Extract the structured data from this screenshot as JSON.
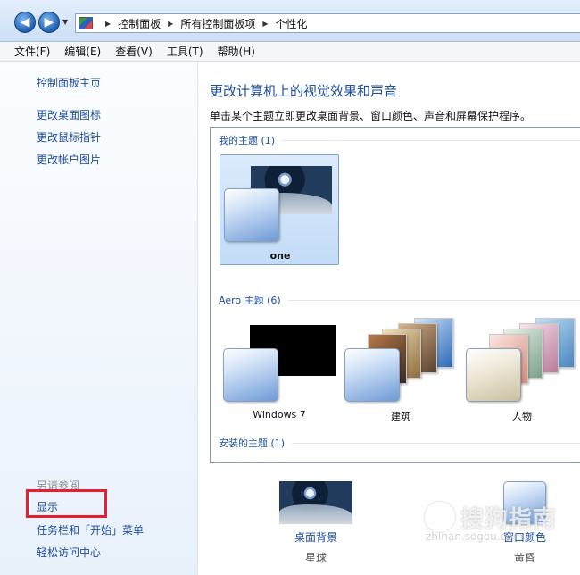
{
  "address": {
    "crumbs": [
      "控制面板",
      "所有控制面板项",
      "个性化"
    ]
  },
  "menu": [
    "文件(F)",
    "编辑(E)",
    "查看(V)",
    "工具(T)",
    "帮助(H)"
  ],
  "sidebar": {
    "home": "控制面板主页",
    "links": [
      "更改桌面图标",
      "更改鼠标指针",
      "更改帐户图片"
    ],
    "see_also": "另请参阅",
    "bottom_links": [
      "显示",
      "任务栏和「开始」菜单",
      "轻松访问中心"
    ]
  },
  "main": {
    "title": "更改计算机上的视觉效果和声音",
    "subtitle": "单击某个主题立即更改桌面背景、窗口颜色、声音和屏幕保护程序。",
    "groups": {
      "my": "我的主题 (1)",
      "aero": "Aero 主题 (6)",
      "installed": "安装的主题 (1)"
    },
    "themes": {
      "one": "one",
      "win7": "Windows 7",
      "arch": "建筑",
      "people": "人物"
    },
    "options": {
      "background": {
        "label": "桌面背景",
        "value": "星球"
      },
      "color": {
        "label": "窗口颜色",
        "value": "黄昏"
      }
    }
  },
  "watermark": {
    "text": "搜狗指南",
    "sub": "zhinan.sogou.com"
  }
}
